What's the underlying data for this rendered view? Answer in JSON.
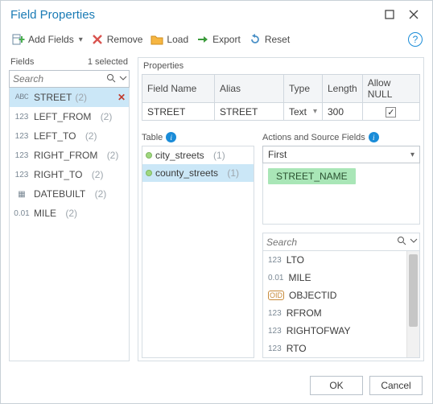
{
  "window": {
    "title": "Field Properties"
  },
  "toolbar": {
    "add": "Add Fields",
    "remove": "Remove",
    "load": "Load",
    "export": "Export",
    "reset": "Reset"
  },
  "fields": {
    "header": "Fields",
    "selected": "1 selected",
    "search_placeholder": "Search",
    "items": [
      {
        "icon": "ABC",
        "name": "STREET",
        "count": "(2)",
        "selected": true
      },
      {
        "icon": "123",
        "name": "LEFT_FROM",
        "count": "(2)"
      },
      {
        "icon": "123",
        "name": "LEFT_TO",
        "count": "(2)"
      },
      {
        "icon": "123",
        "name": "RIGHT_FROM",
        "count": "(2)"
      },
      {
        "icon": "123",
        "name": "RIGHT_TO",
        "count": "(2)"
      },
      {
        "icon": "▦",
        "name": "DATEBUILT",
        "count": "(2)"
      },
      {
        "icon": "0.01",
        "name": "MILE",
        "count": "(2)"
      }
    ]
  },
  "properties": {
    "header": "Properties",
    "columns": {
      "name": "Field Name",
      "alias": "Alias",
      "type": "Type",
      "length": "Length",
      "allownull": "Allow NULL"
    },
    "row": {
      "name": "STREET",
      "alias": "STREET",
      "type": "Text",
      "length": "300",
      "allownull": true
    }
  },
  "tables": {
    "header": "Table",
    "items": [
      {
        "name": "city_streets",
        "count": "(1)"
      },
      {
        "name": "county_streets",
        "count": "(1)",
        "selected": true
      }
    ]
  },
  "actions": {
    "header": "Actions and Source Fields",
    "merge_rule": "First",
    "chip": "STREET_NAME",
    "search_placeholder": "Search",
    "sources": [
      {
        "icon": "123",
        "name": "LTO"
      },
      {
        "icon": "0.01",
        "name": "MILE"
      },
      {
        "icon": "OID",
        "name": "OBJECTID"
      },
      {
        "icon": "123",
        "name": "RFROM"
      },
      {
        "icon": "123",
        "name": "RIGHTOFWAY"
      },
      {
        "icon": "123",
        "name": "RTO"
      }
    ]
  },
  "footer": {
    "ok": "OK",
    "cancel": "Cancel"
  }
}
